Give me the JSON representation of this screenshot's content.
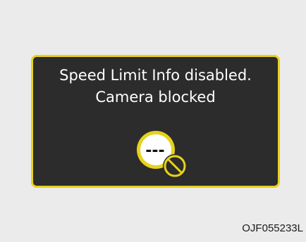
{
  "display": {
    "line1": "Speed Limit Info disabled.",
    "line2": "Camera blocked"
  },
  "icon": {
    "name": "speed-limit-sign-blocked-icon",
    "dashes": "---",
    "ring_color": "#e7d21c",
    "prohibition_color": "#e7d21c"
  },
  "colors": {
    "panel_background": "#2c2c2c",
    "panel_border": "#e7d21c",
    "text": "#ffffff",
    "page_background": "#ebebeb"
  },
  "image_code": "OJF055233L"
}
